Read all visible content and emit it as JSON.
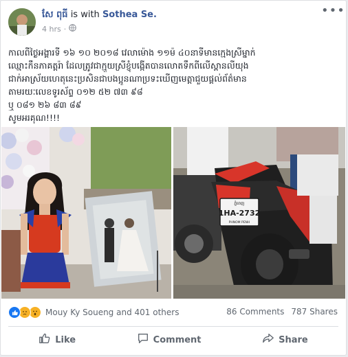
{
  "post": {
    "author": "សែ ពុធី",
    "with_text": "is with",
    "tagged": "Sothea Se.",
    "time": "4 hrs",
    "text_lines": [
      "កាលពីថ្ងៃអង្គារទី ១៦ ១០ ២០១៨ វេលាម៉ោង ១១ម៉ ៤០នាទីមានក្មេងស្រីម្នាក់",
      "ឈ្មោះកឹនភាគត្តរ៉ា ដែលត្រូវជាក្មួយស្រីខ្ញុំបង្កើតបានលោតទឹកពីលើស្ពានលីយុង",
      "ជាក់អាស្រ័យហេតុនេះប្រសិនជាបងប្អូនណាប្រទះឃើញមេត្តាជួយផ្តល់ព័ត៌មាន",
      "តាមរយៈលេខទូរស័ព្ទ ០១២ ៥២ ៧៣ ៩៨",
      "ឬ ០៨១ ២៦ ៨៣ ៨៩",
      "សូមអរគុណ!!!!"
    ],
    "plate_top": "ភ្នំពេញ",
    "plate_main": "1HA-2732",
    "plate_bottom": "PHNOM PENH"
  },
  "reactions": {
    "summary": "Mouy Ky Soueng and 401 others",
    "comments": "86 Comments",
    "shares": "787 Shares",
    "icons": [
      "like-icon",
      "sad-icon",
      "wow-icon"
    ]
  },
  "actions": {
    "like": "Like",
    "comment": "Comment",
    "share": "Share"
  },
  "colors": {
    "link": "#385898",
    "muted": "#606770",
    "like_blue": "#1877f2"
  }
}
